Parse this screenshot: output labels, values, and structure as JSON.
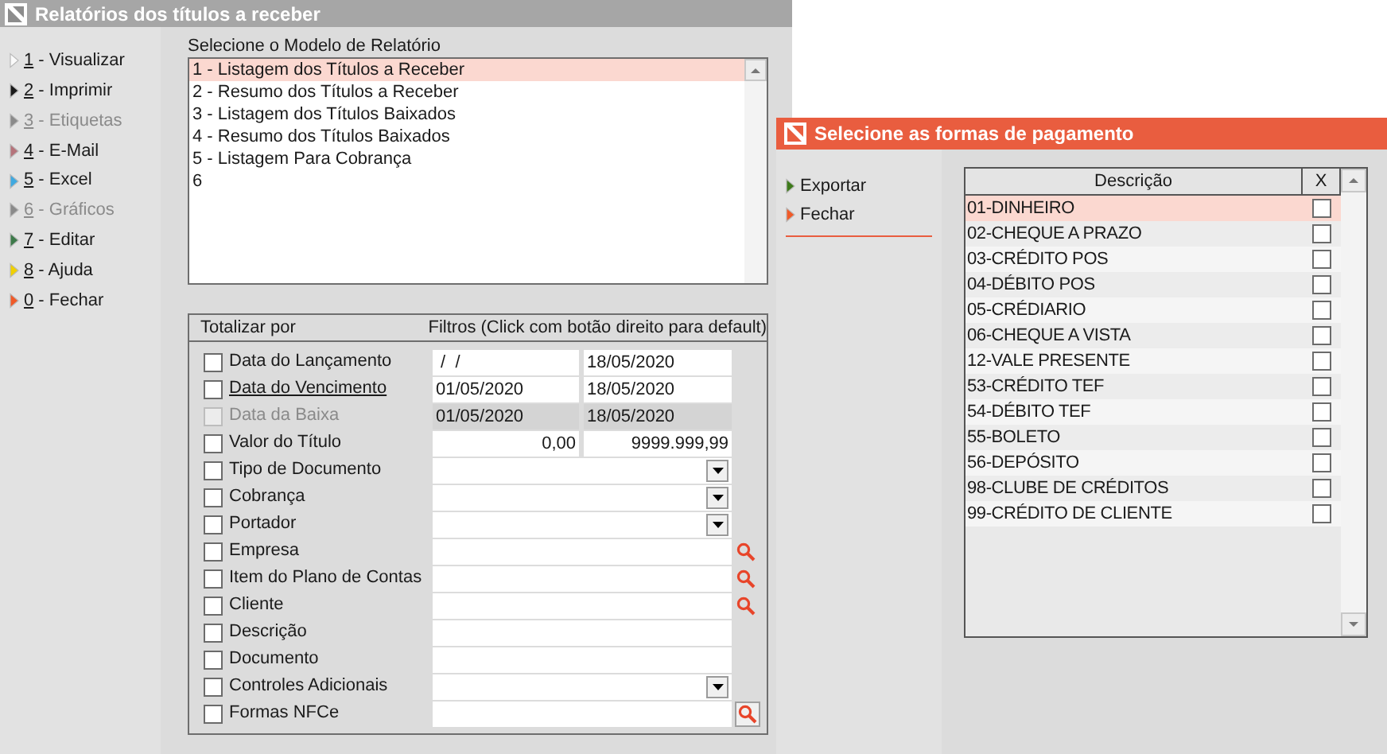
{
  "main_window": {
    "title": "Relatórios dos títulos a receber"
  },
  "sidebar": {
    "items": [
      {
        "key": "1",
        "label": " - Visualizar",
        "color": "#fafafa",
        "disabled": false
      },
      {
        "key": "2",
        "label": " - Imprimir",
        "color": "#1a1a1a",
        "disabled": false
      },
      {
        "key": "3",
        "label": " - Etiquetas",
        "color": "#8a8a8a",
        "disabled": true
      },
      {
        "key": "4",
        "label": " - E-Mail",
        "color": "#b5737a",
        "disabled": false
      },
      {
        "key": "5",
        "label": " - Excel",
        "color": "#3fa9e0",
        "disabled": false
      },
      {
        "key": "6",
        "label": " - Gráficos",
        "color": "#8a8a8a",
        "disabled": true
      },
      {
        "key": "7",
        "label": " - Editar",
        "color": "#3d7a4a",
        "disabled": false
      },
      {
        "key": "8",
        "label": " - Ajuda",
        "color": "#f0d000",
        "disabled": false
      },
      {
        "key": "0",
        "label": " - Fechar",
        "color": "#f05a28",
        "disabled": false
      }
    ]
  },
  "report_models": {
    "title": "Selecione o Modelo de Relatório",
    "items": [
      {
        "label": "1 - Listagem dos Títulos a Receber",
        "selected": true
      },
      {
        "label": "2 - Resumo dos Títulos a Receber",
        "selected": false
      },
      {
        "label": "3 - Listagem dos Títulos Baixados",
        "selected": false
      },
      {
        "label": "4 - Resumo dos Títulos Baixados",
        "selected": false
      },
      {
        "label": "5 - Listagem Para Cobrança",
        "selected": false
      },
      {
        "label": "6",
        "selected": false
      }
    ]
  },
  "filters": {
    "totalize_header": "Totalizar por",
    "filters_header": "Filtros (Click com botão direito para default)",
    "rows": [
      {
        "kind": "date_range",
        "label": "Data do Lançamento",
        "checked": false,
        "disabled": false,
        "underlined": false,
        "from": " /  /",
        "to": "18/05/2020"
      },
      {
        "kind": "date_range",
        "label": "Data do Vencimento",
        "checked": false,
        "disabled": false,
        "underlined": true,
        "from": "01/05/2020",
        "to": "18/05/2020"
      },
      {
        "kind": "date_range",
        "label": "Data da Baixa",
        "checked": false,
        "disabled": true,
        "underlined": false,
        "from": "01/05/2020",
        "to": "18/05/2020"
      },
      {
        "kind": "number_range",
        "label": "Valor do Título",
        "checked": false,
        "disabled": false,
        "underlined": false,
        "from": "0,00",
        "to": "9999.999,99"
      },
      {
        "kind": "dropdown",
        "label": "Tipo de Documento",
        "checked": false,
        "disabled": false,
        "underlined": false
      },
      {
        "kind": "dropdown",
        "label": "Cobrança",
        "checked": false,
        "disabled": false,
        "underlined": false
      },
      {
        "kind": "dropdown",
        "label": "Portador",
        "checked": false,
        "disabled": false,
        "underlined": false
      },
      {
        "kind": "lookup",
        "label": "Empresa",
        "checked": false,
        "disabled": false,
        "underlined": false
      },
      {
        "kind": "lookup",
        "label": "Item do Plano de Contas",
        "checked": false,
        "disabled": false,
        "underlined": false
      },
      {
        "kind": "lookup",
        "label": "Cliente",
        "checked": false,
        "disabled": false,
        "underlined": false
      },
      {
        "kind": "text",
        "label": "Descrição",
        "checked": false,
        "disabled": false,
        "underlined": false
      },
      {
        "kind": "text",
        "label": "Documento",
        "checked": false,
        "disabled": false,
        "underlined": false
      },
      {
        "kind": "dropdown",
        "label": "Controles Adicionais",
        "checked": false,
        "disabled": false,
        "underlined": false
      },
      {
        "kind": "lookup_button",
        "label": "Formas NFCe",
        "checked": false,
        "disabled": false,
        "underlined": false
      }
    ]
  },
  "payment_window": {
    "title": "Selecione as formas de pagamento",
    "actions": [
      {
        "label": "Exportar",
        "color": "#3d7a1a"
      },
      {
        "label": "Fechar",
        "color": "#f05a28"
      }
    ],
    "table": {
      "columns": [
        "Descrição",
        "X"
      ],
      "rows": [
        {
          "label": "01-DINHEIRO",
          "checked": false,
          "selected": true
        },
        {
          "label": "02-CHEQUE A PRAZO",
          "checked": false,
          "selected": false
        },
        {
          "label": "03-CRÉDITO POS",
          "checked": false,
          "selected": false
        },
        {
          "label": "04-DÉBITO POS",
          "checked": false,
          "selected": false
        },
        {
          "label": "05-CRÉDIARIO",
          "checked": false,
          "selected": false
        },
        {
          "label": "06-CHEQUE A VISTA",
          "checked": false,
          "selected": false
        },
        {
          "label": "12-VALE PRESENTE",
          "checked": false,
          "selected": false
        },
        {
          "label": "53-CRÉDITO TEF",
          "checked": false,
          "selected": false
        },
        {
          "label": "54-DÉBITO TEF",
          "checked": false,
          "selected": false
        },
        {
          "label": "55-BOLETO",
          "checked": false,
          "selected": false
        },
        {
          "label": "56-DEPÓSITO",
          "checked": false,
          "selected": false
        },
        {
          "label": "98-CLUBE DE CRÉDITOS",
          "checked": false,
          "selected": false
        },
        {
          "label": "99-CRÉDITO DE CLIENTE",
          "checked": false,
          "selected": false
        }
      ]
    }
  }
}
